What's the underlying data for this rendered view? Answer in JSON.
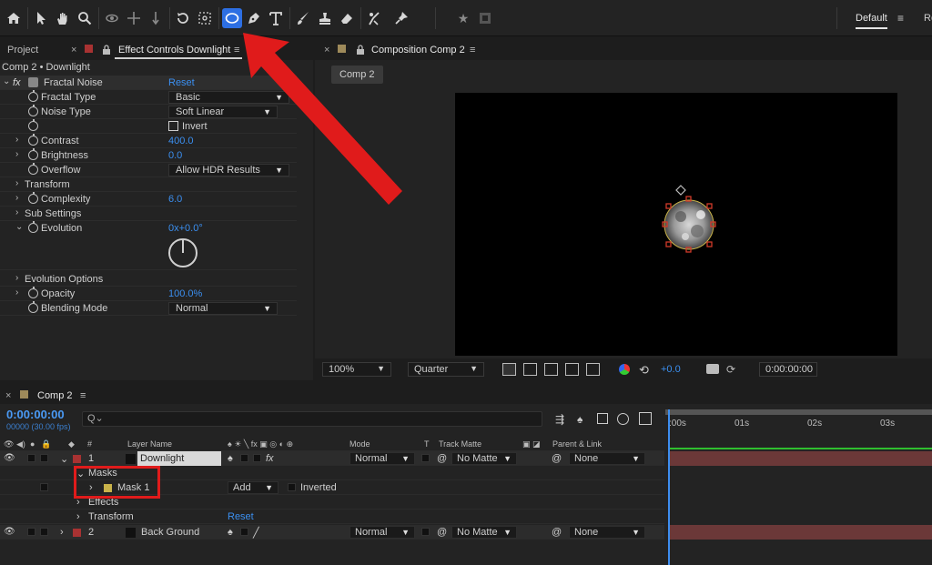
{
  "toolbar": {
    "active_tool": "ellipse-tool",
    "workspace_label": "Default",
    "workspace_menu_icon": "≡",
    "workspace_next_label": "Re"
  },
  "panels": {
    "project_tab": "Project",
    "effect_controls_tab": "Effect Controls Downlight",
    "composition_tab": "Composition Comp 2",
    "close_glyph": "×",
    "menu_glyph": "≡"
  },
  "effect_controls": {
    "breadcrumb": "Comp 2 • Downlight",
    "effect_name": "Fractal Noise",
    "reset_label": "Reset",
    "rows": {
      "fractal_type": {
        "label": "Fractal Type",
        "value": "Basic"
      },
      "noise_type": {
        "label": "Noise Type",
        "value": "Soft Linear"
      },
      "invert": {
        "label": "Invert"
      },
      "contrast": {
        "label": "Contrast",
        "value": "400.0"
      },
      "brightness": {
        "label": "Brightness",
        "value": "0.0"
      },
      "overflow": {
        "label": "Overflow",
        "value": "Allow HDR Results"
      },
      "transform": {
        "label": "Transform"
      },
      "complexity": {
        "label": "Complexity",
        "value": "6.0"
      },
      "sub_settings": {
        "label": "Sub Settings"
      },
      "evolution": {
        "label": "Evolution",
        "value": "0x+0.0°"
      },
      "evolution_options": {
        "label": "Evolution Options"
      },
      "opacity": {
        "label": "Opacity",
        "value": "100.0%"
      },
      "blending_mode": {
        "label": "Blending Mode",
        "value": "Normal"
      }
    }
  },
  "composition": {
    "comp_button": "Comp 2",
    "zoom": "100%",
    "resolution": "Quarter",
    "exposure": "+0.0",
    "timecode": "0:00:00:00"
  },
  "timeline": {
    "comp_tab": "Comp 2",
    "timecode": "0:00:00:00",
    "fps": "00000 (30.00 fps)",
    "search_placeholder": "Q⌄",
    "columns": {
      "number": "#",
      "layer_name": "Layer Name",
      "mode": "Mode",
      "t": "T",
      "track_matte": "Track Matte",
      "parent_link": "Parent & Link"
    },
    "ruler_ticks": [
      "01s",
      "02s",
      "03s"
    ],
    "ruler_start": ":00s",
    "layers": [
      {
        "number": "1",
        "name": "Downlight",
        "mode": "Normal",
        "matte": "No Matte",
        "parent": "None",
        "color": "#a83232"
      },
      {
        "number": "2",
        "name": "Back Ground",
        "mode": "Normal",
        "matte": "No Matte",
        "parent": "None",
        "color": "#a83232"
      }
    ],
    "sub_rows": {
      "masks": "Masks",
      "mask1": "Mask 1",
      "mask1_mode": "Add",
      "inverted": "Inverted",
      "effects": "Effects",
      "transform": "Transform",
      "reset": "Reset"
    }
  },
  "colors": {
    "accent_blue": "#2d6fe3",
    "value_blue": "#3b8ff0",
    "annotation_red": "#e01b1b",
    "label_yellow": "#c9b34a",
    "panel_swatch": "#9e8a5a"
  }
}
